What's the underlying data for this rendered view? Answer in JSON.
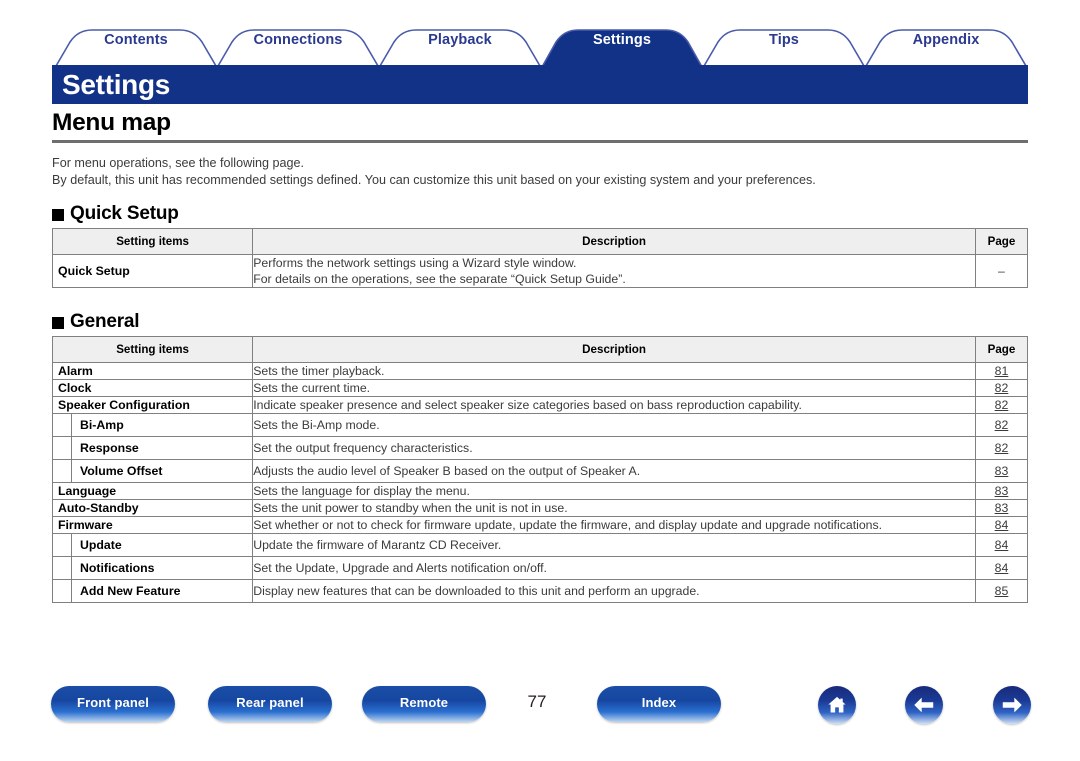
{
  "tabs": [
    {
      "label": "Contents",
      "active": false
    },
    {
      "label": "Connections",
      "active": false
    },
    {
      "label": "Playback",
      "active": false
    },
    {
      "label": "Settings",
      "active": true
    },
    {
      "label": "Tips",
      "active": false
    },
    {
      "label": "Appendix",
      "active": false
    }
  ],
  "header": {
    "band_title": "Settings",
    "page_title": "Menu map"
  },
  "intro": {
    "line1": "For menu operations, see the following page.",
    "line2": "By default, this unit has recommended settings defined. You can customize this unit based on your existing system and your preferences."
  },
  "columns": {
    "item": "Setting items",
    "description": "Description",
    "page": "Page"
  },
  "sections": [
    {
      "heading": "Quick Setup",
      "rows": [
        {
          "level": 1,
          "item": "Quick Setup",
          "desc_lines": [
            "Performs the network settings using a Wizard style window.",
            "For details on the operations, see the separate “Quick Setup Guide”."
          ],
          "page": "–",
          "page_is_link": false
        }
      ]
    },
    {
      "heading": "General",
      "rows": [
        {
          "level": 1,
          "item": "Alarm",
          "desc_lines": [
            "Sets the timer playback."
          ],
          "page": "81",
          "page_is_link": true
        },
        {
          "level": 1,
          "item": "Clock",
          "desc_lines": [
            "Sets the current time."
          ],
          "page": "82",
          "page_is_link": true
        },
        {
          "level": 1,
          "item": "Speaker Configuration",
          "desc_lines": [
            "Indicate speaker presence and select speaker size categories based on bass reproduction capability."
          ],
          "page": "82",
          "page_is_link": true
        },
        {
          "level": 2,
          "item": "Bi-Amp",
          "desc_lines": [
            "Sets the Bi-Amp mode."
          ],
          "page": "82",
          "page_is_link": true
        },
        {
          "level": 2,
          "item": "Response",
          "desc_lines": [
            "Set the output frequency characteristics."
          ],
          "page": "82",
          "page_is_link": true
        },
        {
          "level": 2,
          "item": "Volume Offset",
          "desc_lines": [
            "Adjusts the audio level of Speaker B based on the output of Speaker A."
          ],
          "page": "83",
          "page_is_link": true
        },
        {
          "level": 1,
          "item": "Language",
          "desc_lines": [
            "Sets the language for display the menu."
          ],
          "page": "83",
          "page_is_link": true
        },
        {
          "level": 1,
          "item": "Auto-Standby",
          "desc_lines": [
            "Sets the unit power to standby when the unit is not in use."
          ],
          "page": "83",
          "page_is_link": true
        },
        {
          "level": 1,
          "item": "Firmware",
          "desc_lines": [
            "Set whether or not to check for firmware update, update the firmware, and display update and upgrade notifications."
          ],
          "page": "84",
          "page_is_link": true
        },
        {
          "level": 2,
          "item": "Update",
          "desc_lines": [
            "Update the firmware of Marantz CD Receiver."
          ],
          "page": "84",
          "page_is_link": true
        },
        {
          "level": 2,
          "item": "Notifications",
          "desc_lines": [
            "Set the Update, Upgrade and Alerts notification on/off."
          ],
          "page": "84",
          "page_is_link": true
        },
        {
          "level": 2,
          "item": "Add New Feature",
          "desc_lines": [
            "Display new features that can be downloaded to this unit and perform an upgrade."
          ],
          "page": "85",
          "page_is_link": true
        }
      ]
    }
  ],
  "footer": {
    "buttons": [
      {
        "label": "Front panel",
        "name": "front-panel-button"
      },
      {
        "label": "Rear panel",
        "name": "rear-panel-button"
      },
      {
        "label": "Remote",
        "name": "remote-button"
      },
      {
        "label": "Index",
        "name": "index-button"
      }
    ],
    "page_number": "77",
    "icons": [
      {
        "name": "home-icon",
        "glyph": "home"
      },
      {
        "name": "back-arrow-icon",
        "glyph": "left"
      },
      {
        "name": "next-arrow-icon",
        "glyph": "right"
      }
    ]
  },
  "colors": {
    "brand_navy": "#123288",
    "tab_outline": "#4a5bab",
    "tab_text": "#2b3a8f",
    "rule_gray": "#6e6e6e",
    "table_border": "#808080",
    "header_fill": "#efefef"
  }
}
